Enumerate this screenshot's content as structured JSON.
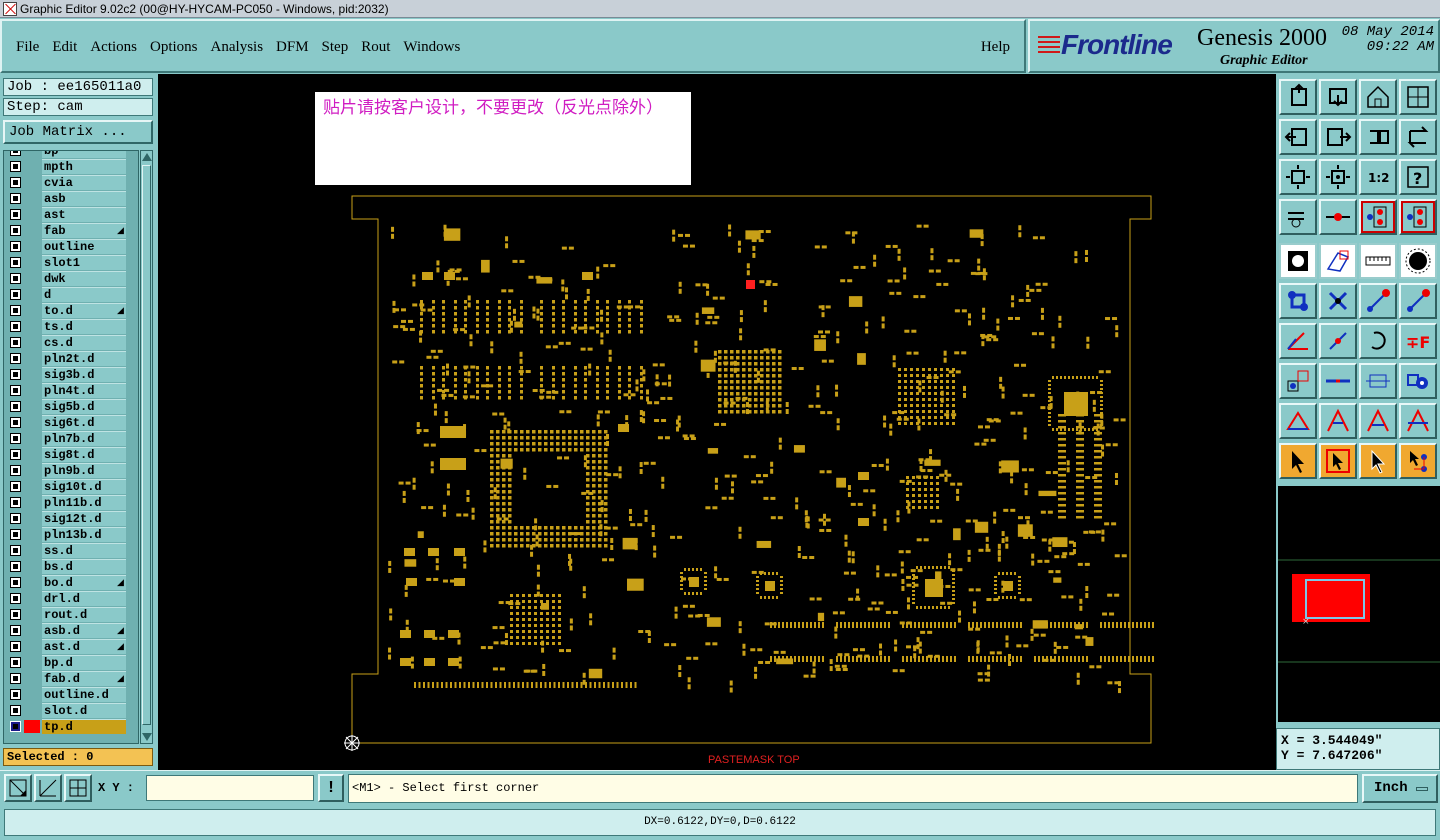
{
  "window": {
    "title": "Graphic Editor 9.02c2 (00@HY-HYCAM-PC050 - Windows, pid:2032)"
  },
  "menu": {
    "items": [
      "File",
      "Edit",
      "Actions",
      "Options",
      "Analysis",
      "DFM",
      "Step",
      "Rout",
      "Windows"
    ],
    "help": "Help"
  },
  "logo": {
    "brand": "Frontline",
    "product": "Genesis 2000",
    "subtitle": "Graphic Editor",
    "date": "08 May 2014",
    "time": "09:22 AM"
  },
  "job": {
    "job_label": "Job : ee165011a0",
    "step_label": "Step: cam",
    "matrix_button": "Job Matrix ..."
  },
  "layers": [
    {
      "name": "bp",
      "lock": false
    },
    {
      "name": "mpth",
      "lock": false
    },
    {
      "name": "cvia",
      "lock": false
    },
    {
      "name": "asb",
      "lock": false
    },
    {
      "name": "ast",
      "lock": false
    },
    {
      "name": "fab",
      "lock": true
    },
    {
      "name": "outline",
      "lock": false
    },
    {
      "name": "slot1",
      "lock": false
    },
    {
      "name": "dwk",
      "lock": false
    },
    {
      "name": "d",
      "lock": false
    },
    {
      "name": "to.d",
      "lock": true
    },
    {
      "name": "ts.d",
      "lock": false
    },
    {
      "name": "cs.d",
      "lock": false
    },
    {
      "name": "pln2t.d",
      "lock": false
    },
    {
      "name": "sig3b.d",
      "lock": false
    },
    {
      "name": "pln4t.d",
      "lock": false
    },
    {
      "name": "sig5b.d",
      "lock": false
    },
    {
      "name": "sig6t.d",
      "lock": false
    },
    {
      "name": "pln7b.d",
      "lock": false
    },
    {
      "name": "sig8t.d",
      "lock": false
    },
    {
      "name": "pln9b.d",
      "lock": false
    },
    {
      "name": "sig10t.d",
      "lock": false
    },
    {
      "name": "pln11b.d",
      "lock": false
    },
    {
      "name": "sig12t.d",
      "lock": false
    },
    {
      "name": "pln13b.d",
      "lock": false
    },
    {
      "name": "ss.d",
      "lock": false
    },
    {
      "name": "bs.d",
      "lock": false
    },
    {
      "name": "bo.d",
      "lock": true
    },
    {
      "name": "drl.d",
      "lock": false
    },
    {
      "name": "rout.d",
      "lock": false
    },
    {
      "name": "asb.d",
      "lock": true
    },
    {
      "name": "ast.d",
      "lock": true
    },
    {
      "name": "bp.d",
      "lock": false
    },
    {
      "name": "fab.d",
      "lock": true
    },
    {
      "name": "outline.d",
      "lock": false
    },
    {
      "name": "slot.d",
      "lock": false
    },
    {
      "name": "tp.d",
      "lock": false,
      "active": true
    }
  ],
  "selected_label": "Selected : 0",
  "canvas": {
    "note": "贴片请按客户设计，不要更改（反光点除外）",
    "layer_label": "PASTEMASK TOP",
    "board_color": "#c8a018",
    "outline_color": "#c8a018"
  },
  "toolbar_icons": [
    "snap-icon",
    "move-icon",
    "home-icon",
    "split-view-icon",
    "pan-left-icon",
    "pan-right-icon",
    "flip-icon",
    "rotate-icon",
    "zoom-fit-icon",
    "zoom-center-icon",
    "ratio-icon",
    "help-icon",
    "measure-icon",
    "origin-icon",
    "net-red-icon",
    "net-blue-icon",
    "fill-icon",
    "edit-shape-icon",
    "ruler-icon",
    "select-circle-icon",
    "connect-icon",
    "cross-icon",
    "line-red-icon",
    "line-blue-icon",
    "angle-icon",
    "slash-icon",
    "arc-icon",
    "text-icon",
    "move-points-icon",
    "cut-icon",
    "scale-icon",
    "pads-icon",
    "triangle-icon",
    "triangle-a-icon",
    "triangle-b-icon",
    "triangle-c-icon",
    "pointer-icon",
    "pointer-box-icon",
    "pointer-select-icon",
    "pointer-net-icon"
  ],
  "toolbar_ratio_text": "1:2",
  "coords": {
    "x": "X = 3.544049\"",
    "y": "Y = 7.647206\""
  },
  "command": {
    "xy_label": "X Y :",
    "xy_value": "",
    "bang": "!",
    "prompt": "<M1> - Select first corner",
    "unit": "Inch"
  },
  "status": "DX=0.6122,DY=0,D=0.6122"
}
